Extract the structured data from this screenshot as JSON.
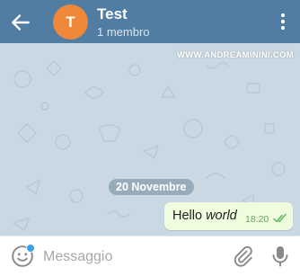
{
  "header": {
    "avatar_letter": "T",
    "title": "Test",
    "subtitle": "1 membro",
    "color": "#517da2",
    "avatar_color": "#f0883a",
    "back_icon": "arrow-left-icon",
    "menu_icon": "more-vertical-icon"
  },
  "chat": {
    "watermark": "WWW.ANDREAMININI.COM",
    "date_label": "20 Novembre",
    "messages": [
      {
        "text_plain": "Hello ",
        "text_italic": "world",
        "time": "18:20",
        "status": "read"
      }
    ],
    "bubble_color": "#effdde",
    "background_color": "#c9d8e2"
  },
  "composer": {
    "placeholder": "Messaggio",
    "emoji_icon": "emoji-icon",
    "attach_icon": "paperclip-icon",
    "mic_icon": "microphone-icon"
  }
}
